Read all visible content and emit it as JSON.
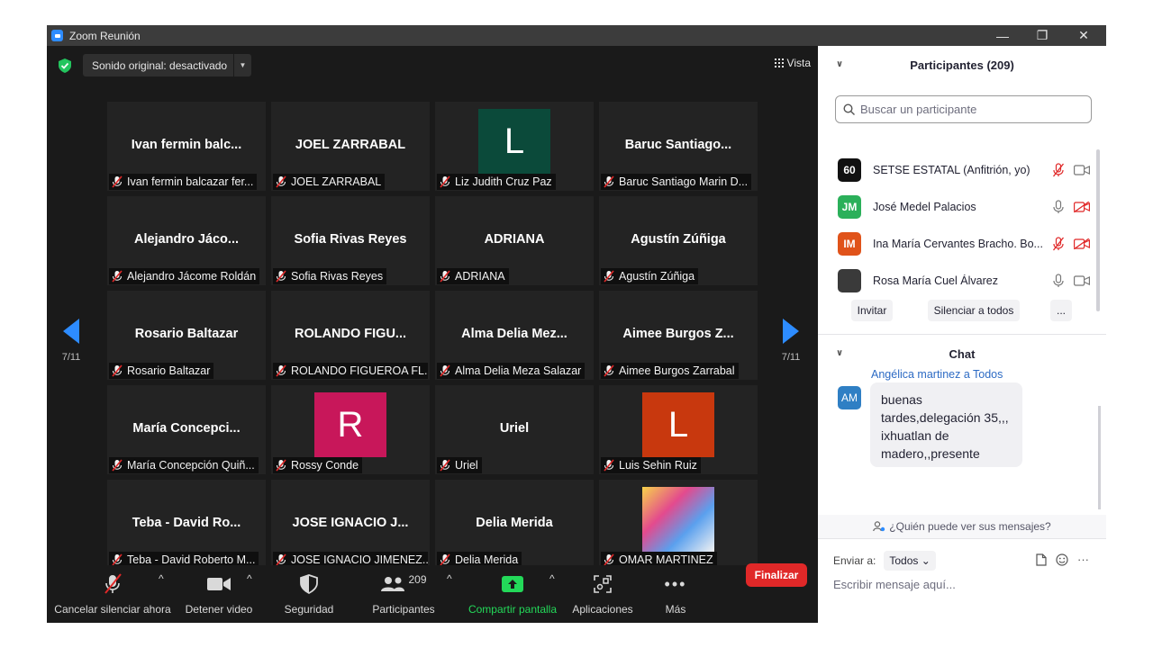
{
  "window": {
    "title": "Zoom Reunión"
  },
  "video": {
    "sound_label": "Sonido original: desactivado",
    "view_label": "Vista",
    "page_indicator": "7/11",
    "tiles": [
      {
        "big": "Ivan fermin balc...",
        "name": "Ivan fermin balcazar fer..."
      },
      {
        "big": "JOEL ZARRABAL",
        "name": "JOEL ZARRABAL"
      },
      {
        "avatar": "L",
        "avatar_color": "#0b4a3a",
        "name": "Liz Judith Cruz Paz"
      },
      {
        "big": "Baruc  Santiago...",
        "name": "Baruc Santiago Marin D..."
      },
      {
        "big": "Alejandro  Jáco...",
        "name": "Alejandro Jácome Roldán"
      },
      {
        "big": "Sofia Rivas Reyes",
        "name": "Sofia Rivas Reyes"
      },
      {
        "big": "ADRIANA",
        "name": "ADRIANA"
      },
      {
        "big": "Agustín Zúñiga",
        "name": "Agustín Zúñiga"
      },
      {
        "big": "Rosario Baltazar",
        "name": "Rosario Baltazar"
      },
      {
        "big": "ROLANDO  FIGU...",
        "name": "ROLANDO FIGUEROA FL..."
      },
      {
        "big": "Alma Delia Mez...",
        "name": "Alma Delia Meza Salazar"
      },
      {
        "big": "Aimee Burgos Z...",
        "name": "Aimee Burgos Zarrabal"
      },
      {
        "big": "María  Concepci...",
        "name": "María Concepción Quiñ..."
      },
      {
        "avatar": "R",
        "avatar_color": "#c8175a",
        "name": "Rossy Conde"
      },
      {
        "big": "Uriel",
        "name": "Uriel"
      },
      {
        "avatar": "L",
        "avatar_color": "#c8380e",
        "name": "Luis Sehin Ruiz"
      },
      {
        "big": "Teba - David Ro...",
        "name": "Teba - David Roberto M..."
      },
      {
        "big": "JOSE IGNACIO J...",
        "name": "JOSE IGNACIO JIMENEZ..."
      },
      {
        "big": "Delia Merida",
        "name": "Delia Merida"
      },
      {
        "photo": true,
        "name": "OMAR MARTINEZ"
      }
    ]
  },
  "toolbar": {
    "unmute": "Cancelar silenciar ahora",
    "stop_video": "Detener video",
    "security": "Seguridad",
    "participants": "Participantes",
    "participants_count": "209",
    "share": "Compartir pantalla",
    "apps": "Aplicaciones",
    "more": "Más",
    "end": "Finalizar",
    "share_color": "#23d959"
  },
  "participants_panel": {
    "title": "Participantes (209)",
    "search_placeholder": "Buscar un participante",
    "rows": [
      {
        "initials": "60",
        "color": "#111111",
        "name": "SETSE ESTATAL (Anfitrión, yo)",
        "muted": true,
        "video_off": false
      },
      {
        "initials": "JM",
        "color": "#2bb05a",
        "name": "José Medel Palacios",
        "muted": false,
        "video_off": true
      },
      {
        "initials": "IM",
        "color": "#e0531a",
        "name": "Ina María Cervantes Bracho. Bo...",
        "muted": true,
        "video_off": true
      },
      {
        "initials": "",
        "color": "#3a3a3a",
        "name": "Rosa María Cuel Álvarez",
        "muted": false,
        "video_off": false
      }
    ],
    "invite": "Invitar",
    "mute_all": "Silenciar a todos",
    "more": "..."
  },
  "chat": {
    "title": "Chat",
    "sender": "Angélica martinez a Todos",
    "sender_initials": "AM",
    "message": "buenas tardes,delegación 35,,, ixhuatlan de madero,,presente",
    "privacy": "¿Quién puede ver sus mensajes?",
    "send_to_label": "Enviar a:",
    "send_to_value": "Todos",
    "input_placeholder": "Escribir mensaje aquí...",
    "more": "···"
  }
}
